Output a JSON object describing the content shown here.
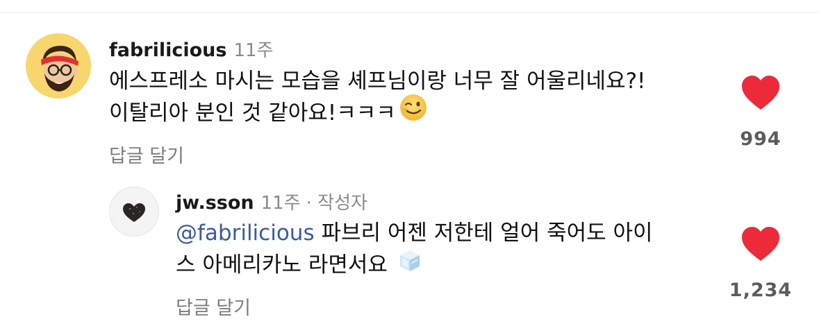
{
  "colors": {
    "heart": "#ec2a3a",
    "mention": "#3a5aa0",
    "meta": "#8a8a8a"
  },
  "comments": [
    {
      "username": "fabrilicious",
      "time": "11주",
      "text_line1": "에스프레소 마시는 모습을 셰프님이랑 너무 잘 어울리네요?!",
      "text_line2": "이탈리아 분인 것 같아요!ㅋㅋㅋ",
      "emoji": "winking-face-icon",
      "reply_label": "답글 달기",
      "like_count": "994"
    },
    {
      "username": "jw.sson",
      "time": "11주",
      "author_badge": "· 작성자",
      "mention": "@fabrilicious",
      "text_line1": " 파브리 어젠 저한테 얼어 죽어도 아이",
      "text_line2": "스 아메리카노 라면서요",
      "emoji": "ice-cube-icon",
      "reply_label": "답글 달기",
      "like_count": "1,234"
    }
  ]
}
